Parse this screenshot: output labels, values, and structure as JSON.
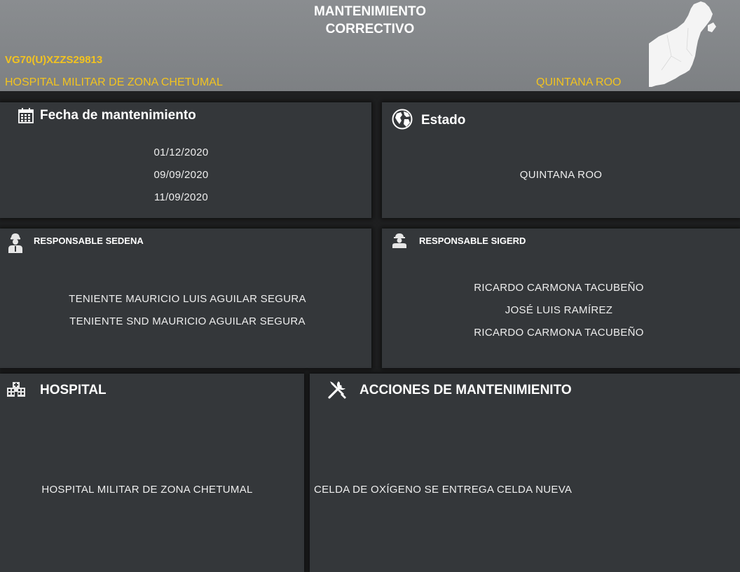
{
  "header": {
    "title_line1": "MANTENIMIENTO",
    "title_line2": "CORRECTIVO",
    "equipment_code": "VG70(U)XZZS29813",
    "hospital": "HOSPITAL MILITAR DE ZONA CHETUMAL",
    "state": "QUINTANA ROO"
  },
  "fecha": {
    "title": "Fecha de mantenimiento",
    "icon": "calendar-icon",
    "dates": [
      "01/12/2020",
      "09/09/2020",
      "11/09/2020"
    ]
  },
  "estado": {
    "title": "Estado",
    "icon": "globe-icon",
    "value": "QUINTANA ROO"
  },
  "sedena": {
    "title": "RESPONSABLE SEDENA",
    "icon": "soldier-icon",
    "names": [
      "TENIENTE MAURICIO LUIS AGUILAR SEGURA",
      "TENIENTE SND MAURICIO AGUILAR SEGURA"
    ]
  },
  "sigerd": {
    "title": "RESPONSABLE SIGERD",
    "icon": "person-icon",
    "names": [
      "RICARDO CARMONA TACUBEÑO",
      "JOSÉ LUIS RAMÍREZ",
      "RICARDO CARMONA TACUBEÑO"
    ]
  },
  "hospital": {
    "title": "HOSPITAL",
    "icon": "hospital-icon",
    "value": "HOSPITAL MILITAR DE ZONA CHETUMAL"
  },
  "acciones": {
    "title": "ACCIONES DE MANTENIMIENITO",
    "icon": "tools-icon",
    "value": "CELDA DE OXÍGENO  SE ENTREGA CELDA NUEVA"
  },
  "colors": {
    "header_bg": "#848789",
    "card_bg": "#34373a",
    "accent_yellow": "#f2c320"
  }
}
